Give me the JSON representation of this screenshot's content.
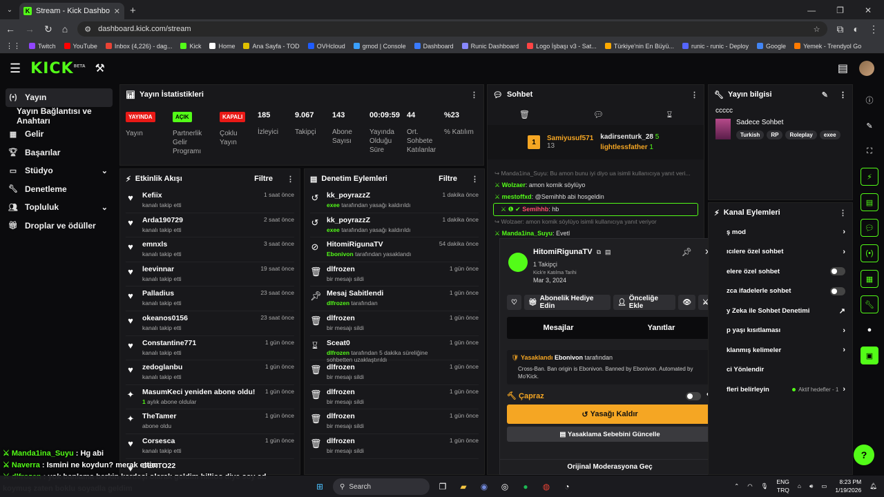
{
  "browser": {
    "tab_title": "Stream - Kick Dashboard",
    "url": "dashboard.kick.com/stream",
    "bookmarks": [
      {
        "label": "Twitch",
        "color": "#9146ff"
      },
      {
        "label": "YouTube",
        "color": "#ff0000"
      },
      {
        "label": "Inbox (4,226) - dag...",
        "color": "#ea4335"
      },
      {
        "label": "Kick",
        "color": "#53fc18"
      },
      {
        "label": "Home",
        "color": "#ffffff"
      },
      {
        "label": "Ana Sayfa - TOD",
        "color": "#e0c000"
      },
      {
        "label": "OVHcloud",
        "color": "#1e5cff"
      },
      {
        "label": "gmod | Console",
        "color": "#3aa0ff"
      },
      {
        "label": "Dashboard",
        "color": "#3a7bff"
      },
      {
        "label": "Runic Dashboard",
        "color": "#8888ff"
      },
      {
        "label": "Logo İşbaşı v3 - Sat...",
        "color": "#ff4444"
      },
      {
        "label": "Türkiye'nin En Büyü...",
        "color": "#ffaa00"
      },
      {
        "label": "runic - runic - Deploy",
        "color": "#5566ff"
      },
      {
        "label": "Google",
        "color": "#4285f4"
      },
      {
        "label": "Yemek - Trendyol Go",
        "color": "#ff7a00"
      }
    ]
  },
  "header": {
    "logo": "KICK",
    "beta": "BETA"
  },
  "sidebar": {
    "items": [
      {
        "label": "Yayın",
        "icon": "broadcast-icon"
      },
      {
        "label": "Yayın Bağlantısı ve Anahtarı"
      },
      {
        "label": "Gelir",
        "icon": "income-icon"
      },
      {
        "label": "Başarılar",
        "icon": "trophy-icon"
      },
      {
        "label": "Stüdyo",
        "icon": "studio-icon"
      },
      {
        "label": "Denetleme",
        "icon": "wrench-icon"
      },
      {
        "label": "Topluluk",
        "icon": "community-icon"
      },
      {
        "label": "Droplar ve ödüller",
        "icon": "gift-icon"
      }
    ]
  },
  "stats": {
    "title": "Yayın İstatistikleri",
    "badges": [
      {
        "badge": "YAYINDA",
        "label": "Yayın",
        "bg": "#e91916",
        "fg": "#ffffff"
      },
      {
        "badge": "AÇIK",
        "label": "Partnerlik Gelir Programı",
        "bg": "#53fc18",
        "fg": "#000000"
      },
      {
        "badge": "KAPALI",
        "label": "Çoklu Yayın",
        "bg": "#e91916",
        "fg": "#ffffff"
      }
    ],
    "numbers": [
      {
        "value": "185",
        "label": "İzleyici"
      },
      {
        "value": "9.067",
        "label": "Takipçi"
      },
      {
        "value": "143",
        "label": "Abone Sayısı"
      },
      {
        "value": "00:09:59",
        "label": "Yayında Olduğu Süre"
      },
      {
        "value": "44",
        "label": "Ort. Sohbete Katılanlar"
      },
      {
        "value": "%23",
        "label": "% Katılım"
      }
    ]
  },
  "activity": {
    "title": "Etkinlik Akışı",
    "filter": "Filtre",
    "items": [
      {
        "name": "Kefiix",
        "sub": "kanalı takip etti",
        "time": "1 saat önce",
        "icon": "heart"
      },
      {
        "name": "Arda190729",
        "sub": "kanalı takip etti",
        "time": "2 saat önce",
        "icon": "heart"
      },
      {
        "name": "emnxls",
        "sub": "kanalı takip etti",
        "time": "3 saat önce",
        "icon": "heart"
      },
      {
        "name": "leevinnar",
        "sub": "kanalı takip etti",
        "time": "19 saat önce",
        "icon": "heart"
      },
      {
        "name": "Palladius",
        "sub": "kanalı takip etti",
        "time": "23 saat önce",
        "icon": "heart"
      },
      {
        "name": "okeanos0156",
        "sub": "kanalı takip etti",
        "time": "23 saat önce",
        "icon": "heart"
      },
      {
        "name": "Constantine771",
        "sub": "kanalı takip etti",
        "time": "1 gün önce",
        "icon": "heart"
      },
      {
        "name": "zedoglanbu",
        "sub": "kanalı takip etti",
        "time": "1 gün önce",
        "icon": "heart"
      },
      {
        "name": "MasumKeci yeniden abone oldu!",
        "sub_green": "1",
        "sub": " aylık abone oldular",
        "time": "1 gün önce",
        "icon": "sparkle"
      },
      {
        "name": "TheTamer",
        "sub": "abone oldu",
        "time": "1 gün önce",
        "icon": "sparkle"
      },
      {
        "name": "Corsesca",
        "sub": "kanalı takip etti",
        "time": "1 gün önce",
        "icon": "heart"
      },
      {
        "name": "DERTO22",
        "sub": "",
        "time": "",
        "icon": "heart"
      }
    ]
  },
  "moderation": {
    "title": "Denetim Eylemleri",
    "filter": "Filtre",
    "items": [
      {
        "name": "kk_poyrazzZ",
        "green": "exee",
        "sub": " tarafından yasağı kaldırıldı",
        "time": "1 dakika önce",
        "icon": "undo"
      },
      {
        "name": "kk_poyrazzZ",
        "green": "exee",
        "sub": " tarafından yasağı kaldırıldı",
        "time": "1 dakika önce",
        "icon": "undo"
      },
      {
        "name": "HitomiRigunaTV",
        "green": "Ebonivon",
        "sub": " tarafından yasaklandı",
        "time": "54 dakika önce",
        "icon": "ban"
      },
      {
        "name": "dlfrozen",
        "green": "",
        "sub": "bir mesajı sildi",
        "time": "1 gün önce",
        "icon": "trash"
      },
      {
        "name": "Mesaj Sabitlendi",
        "green": "dlfrozen",
        "sub": " tarafından",
        "time": "1 gün önce",
        "icon": "pin"
      },
      {
        "name": "dlfrozen",
        "green": "",
        "sub": "bir mesajı sildi",
        "time": "1 gün önce",
        "icon": "trash"
      },
      {
        "name": "Sceat0",
        "green": "dlfrozen",
        "sub": " tarafından 5 dakika süreliğine sohbetten uzaklaştırıldı",
        "time": "1 gün önce",
        "icon": "hourglass"
      },
      {
        "name": "dlfrozen",
        "green": "",
        "sub": "bir mesajı sildi",
        "time": "1 gün önce",
        "icon": "trash"
      },
      {
        "name": "dlfrozen",
        "green": "",
        "sub": "bir mesajı sildi",
        "time": "1 gün önce",
        "icon": "trash"
      },
      {
        "name": "dlfrozen",
        "green": "",
        "sub": "bir mesajı sildi",
        "time": "1 gün önce",
        "icon": "trash"
      },
      {
        "name": "dlfrozen",
        "green": "",
        "sub": "bir mesajı sildi",
        "time": "1 gün önce",
        "icon": "trash"
      }
    ]
  },
  "chat": {
    "title": "Sohbet",
    "top_gifter": {
      "rank": "1",
      "name": "Samiyusuf571",
      "count": "13"
    },
    "gifter_2": {
      "name": "kadirsenturk_28",
      "count": "5"
    },
    "gifter_3": {
      "name": "lightlessfather",
      "count": "1"
    },
    "messages": [
      {
        "reply": "Manda1ina_Suyu: Bu amon bunu iyi diyo ua isimli kullanıcıya yanıt veri..."
      },
      {
        "user": "Wolzaer",
        "color": "#53fc18",
        "text": ": amon komik söylüyo"
      },
      {
        "user": "mestoffxd",
        "color": "#53fc18",
        "text": ": @Semihhb abi hosgeldin"
      },
      {
        "user": "Semihhb",
        "color": "#ff4d6d",
        "text": ": hb",
        "highlight": true
      },
      {
        "reply": "Wolzaer: amon komik söylüyo isimli kullanıcıya yanıt veriyor"
      },
      {
        "user": "Manda1ina_Suyu",
        "color": "#53fc18",
        "text": ": Evetl"
      }
    ]
  },
  "usercard": {
    "name": "HitomiRigunaTV",
    "followers": "1 Takipçi",
    "joined_label": "Kick'e Katılma Tarihi",
    "joined_date": "Mar 3, 2024",
    "gift_btn": "Abonelik Hediye Edin",
    "priority_btn": "Önceliğe Ekle",
    "tab_messages": "Mesajlar",
    "tab_replies": "Yanıtlar",
    "banned_label": "Yasaklandı",
    "banned_by": "Ebonivon",
    "banned_suffix": " tarafından",
    "ban_reason": "Cross-Ban. Ban origin is Ebonivon. Banned by Ebonivon. Automated by Mo'Kick.",
    "cross_label": "Çapraz",
    "unban_label": "Yasağı Kaldır",
    "update_label": "Yasaklama Sebebini Güncelle",
    "orig_mod": "Orijinal Moderasyona Geç"
  },
  "info": {
    "title": "Yayın bilgisi",
    "stream_title": "ccccc",
    "category": "Sadece Sohbet",
    "tags": [
      "Turkish",
      "RP",
      "Roleplay",
      "exee"
    ]
  },
  "channel_actions": {
    "title": "Kanal Eylemleri",
    "items": [
      {
        "label": "ş mod",
        "kind": "arrow"
      },
      {
        "label": "ıcılere özel sohbet",
        "kind": "arrow"
      },
      {
        "label": "elere özel sohbet",
        "kind": "toggle"
      },
      {
        "label": "zca ifadelerle sohbet",
        "kind": "toggle"
      },
      {
        "label": "y Zeka ile Sohbet Denetimi",
        "kind": "ext"
      },
      {
        "label": "p yaşı kısıtlaması",
        "kind": "arrow"
      },
      {
        "label": "klanmış kelimeler",
        "kind": "arrow"
      },
      {
        "label": "ci Yönlendir",
        "kind": "none"
      },
      {
        "label": "fleri belirleyin",
        "kind": "goals",
        "extra": "Aktif hedefler - 1"
      }
    ]
  },
  "overlay_chat": [
    {
      "user": "Manda1ina_Suyu",
      "color": "#53fc18",
      "text": ": Hg abi"
    },
    {
      "user": "Naverra",
      "color": "#53fc18",
      "text": ": Ismini ne koydun? merak ettim"
    },
    {
      "user": "dlfrozen",
      "color": "#53fc18",
      "text": ": yok banlama berkin kardeşi olarak geldim hillios diye soy ad"
    },
    {
      "user": "",
      "color": "#ffffff",
      "text": "koymuş zaten boklu soyadla geldim"
    }
  ],
  "taskbar": {
    "search": "Search",
    "lang1": "ENG",
    "lang2": "TRQ",
    "time": "8:23 PM",
    "date": "1/19/2026"
  }
}
